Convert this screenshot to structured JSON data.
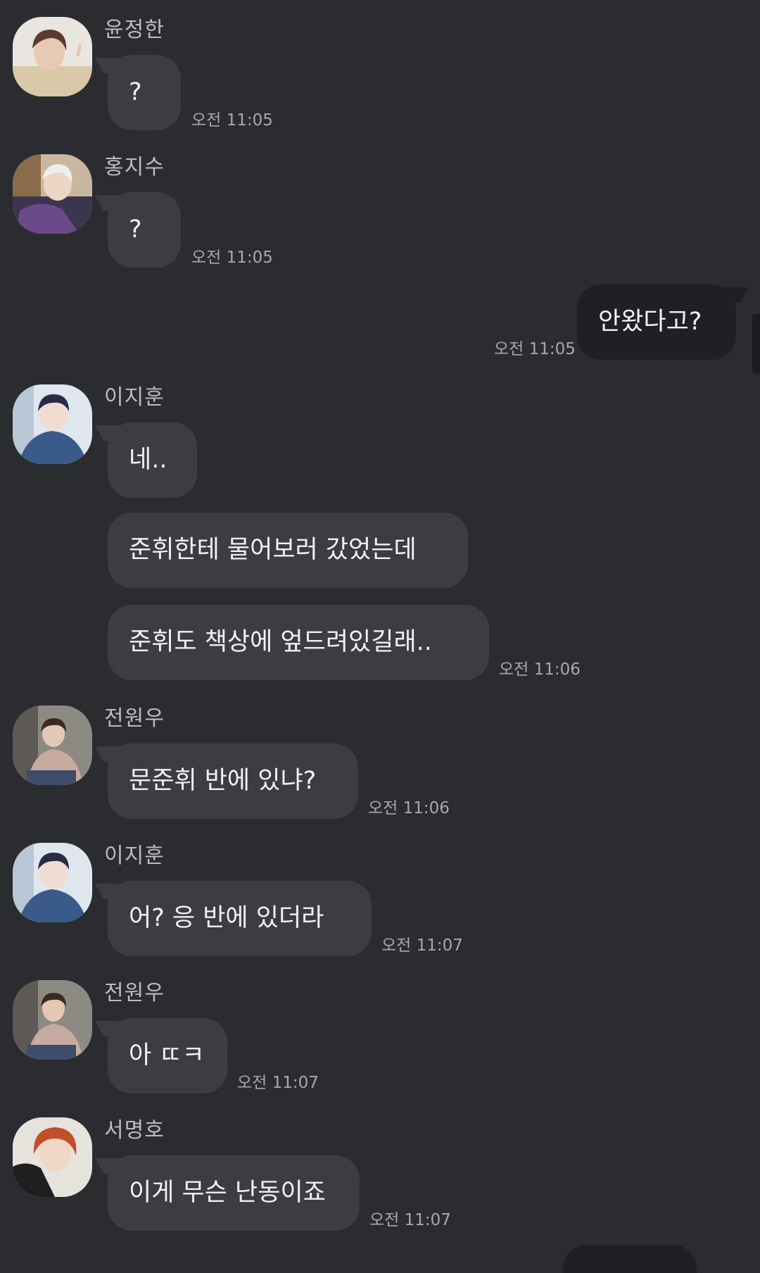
{
  "colors": {
    "background": "#2a2c30",
    "incoming_bubble": "#3b3d42",
    "outgoing_bubble": "#1f2023",
    "message_text": "#f1f1f2",
    "sender_text": "#b9bcc2",
    "time_text": "#a5a8ad"
  },
  "messages": [
    {
      "sender": "윤정한",
      "text": "?",
      "time": "오전 11:05"
    },
    {
      "sender": "홍지수",
      "text": "?",
      "time": "오전 11:05"
    },
    {
      "text": "안왔다고?",
      "time": "오전 11:05"
    },
    {
      "sender": "이지훈",
      "lines": [
        "네..",
        "준휘한테 물어보러 갔었는데",
        "준휘도 책상에 엎드려있길래.."
      ],
      "time": "오전 11:06"
    },
    {
      "sender": "전원우",
      "text": "문준휘 반에 있냐?",
      "time": "오전 11:06"
    },
    {
      "sender": "이지훈",
      "text": "어? 응 반에 있더라",
      "time": "오전 11:07"
    },
    {
      "sender": "전원우",
      "text": "아 ㄸㅋ",
      "time": "오전 11:07"
    },
    {
      "sender": "서명호",
      "text": "이게 무슨 난동이죠",
      "time": "오전 11:07"
    }
  ]
}
